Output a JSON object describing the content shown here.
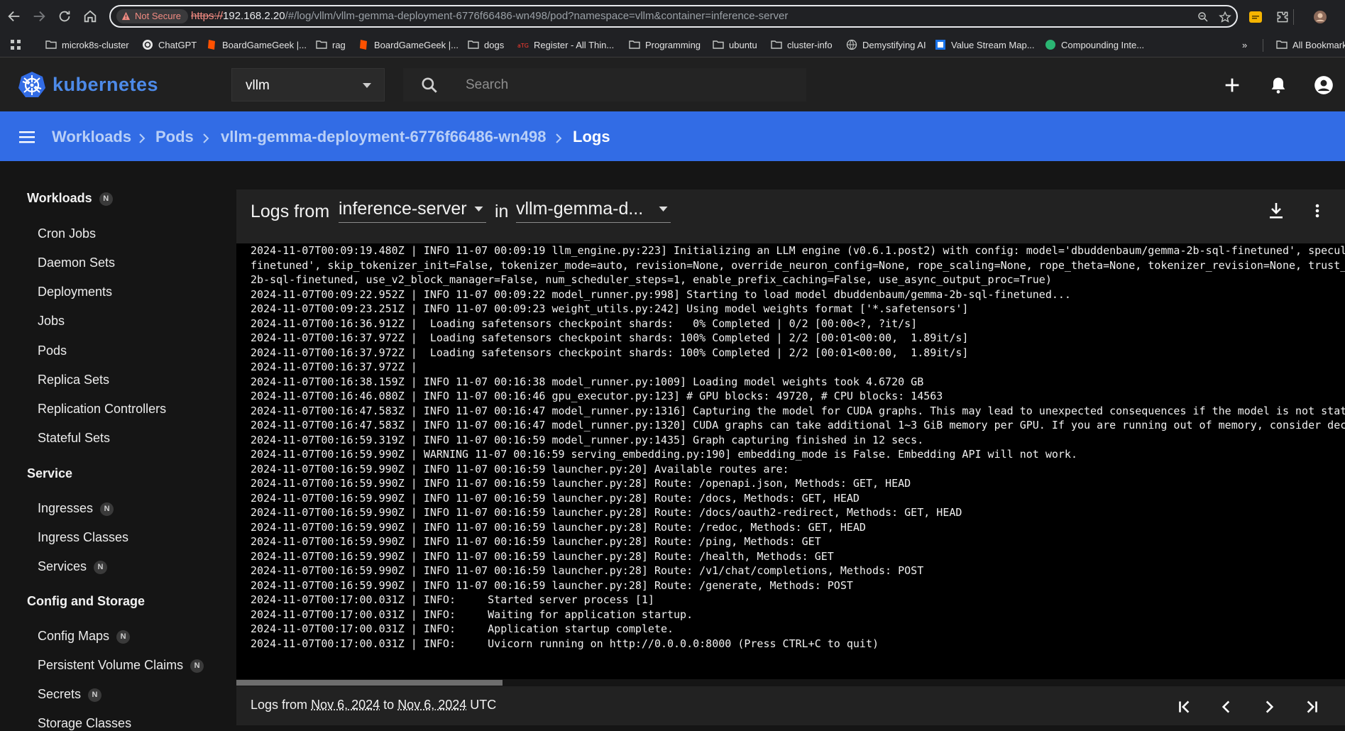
{
  "browser": {
    "security_label": "Not Secure",
    "url_scheme": "https://",
    "url_host": "192.168.2.20",
    "url_rest": "/#/log/vllm/vllm-gemma-deployment-6776f66486-wn498/pod?namespace=vllm&container=inference-server",
    "bookmarks": [
      {
        "label": "microk8s-cluster",
        "icon": "folder-icon"
      },
      {
        "label": "ChatGPT",
        "icon": "chatgpt-icon"
      },
      {
        "label": "BoardGameGeek |...",
        "icon": "boardgamegeek-icon"
      },
      {
        "label": "rag",
        "icon": "folder-icon"
      },
      {
        "label": "BoardGameGeek |...",
        "icon": "boardgamegeek-icon"
      },
      {
        "label": "dogs",
        "icon": "folder-icon"
      },
      {
        "label": "Register - All Thin...",
        "icon": "register-icon"
      },
      {
        "label": "Programming",
        "icon": "folder-icon"
      },
      {
        "label": "ubuntu",
        "icon": "folder-icon"
      },
      {
        "label": "cluster-info",
        "icon": "folder-icon"
      },
      {
        "label": "Demystifying AI",
        "icon": "globe-icon"
      },
      {
        "label": "Value Stream Map...",
        "icon": "site-icon"
      },
      {
        "label": "Compounding Inte...",
        "icon": "site-icon"
      }
    ],
    "more_label": "»",
    "all_bookmarks_label": "All Bookmarks"
  },
  "app": {
    "name": "kubernetes",
    "namespace": "vllm",
    "search_placeholder": "Search",
    "brand_color": "#326ce5"
  },
  "breadcrumb": [
    "Workloads",
    "Pods",
    "vllm-gemma-deployment-6776f66486-wn498",
    "Logs"
  ],
  "sidebar": {
    "workloads": {
      "title": "Workloads",
      "badge": "N",
      "items": [
        "Cron Jobs",
        "Daemon Sets",
        "Deployments",
        "Jobs",
        "Pods",
        "Replica Sets",
        "Replication Controllers",
        "Stateful Sets"
      ]
    },
    "service": {
      "title": "Service",
      "items": [
        {
          "label": "Ingresses",
          "badge": "N"
        },
        {
          "label": "Ingress Classes",
          "badge": ""
        },
        {
          "label": "Services",
          "badge": "N"
        }
      ]
    },
    "config": {
      "title": "Config and Storage",
      "items": [
        {
          "label": "Config Maps",
          "badge": "N"
        },
        {
          "label": "Persistent Volume Claims",
          "badge": "N"
        },
        {
          "label": "Secrets",
          "badge": "N"
        },
        {
          "label": "Storage Classes",
          "badge": ""
        }
      ]
    }
  },
  "logs": {
    "prefix": "Logs from",
    "container": "inference-server",
    "in_label": "in",
    "pod": "vllm-gemma-d...",
    "lines": [
      "2024-11-07T00:09:19.480Z | INFO 11-07 00:09:19 llm_engine.py:223] Initializing an LLM engine (v0.6.1.post2) with config: model='dbuddenbaum/gemma-2b-sql-finetuned', specul",
      "finetuned', skip_tokenizer_init=False, tokenizer_mode=auto, revision=None, override_neuron_config=None, rope_scaling=None, rope_theta=None, tokenizer_revision=None, trust_",
      "2b-sql-finetuned, use_v2_block_manager=False, num_scheduler_steps=1, enable_prefix_caching=False, use_async_output_proc=True)",
      "2024-11-07T00:09:22.952Z | INFO 11-07 00:09:22 model_runner.py:998] Starting to load model dbuddenbaum/gemma-2b-sql-finetuned...",
      "2024-11-07T00:09:23.251Z | INFO 11-07 00:09:23 weight_utils.py:242] Using model weights format ['*.safetensors']",
      "2024-11-07T00:16:36.912Z |  Loading safetensors checkpoint shards:   0% Completed | 0/2 [00:00<?, ?it/s]",
      "2024-11-07T00:16:37.972Z |  Loading safetensors checkpoint shards: 100% Completed | 2/2 [00:01<00:00,  1.89it/s]",
      "2024-11-07T00:16:37.972Z |  Loading safetensors checkpoint shards: 100% Completed | 2/2 [00:01<00:00,  1.89it/s]",
      "2024-11-07T00:16:37.972Z |",
      "2024-11-07T00:16:38.159Z | INFO 11-07 00:16:38 model_runner.py:1009] Loading model weights took 4.6720 GB",
      "2024-11-07T00:16:46.080Z | INFO 11-07 00:16:46 gpu_executor.py:123] # GPU blocks: 49720, # CPU blocks: 14563",
      "2024-11-07T00:16:47.583Z | INFO 11-07 00:16:47 model_runner.py:1316] Capturing the model for CUDA graphs. This may lead to unexpected consequences if the model is not stat",
      "2024-11-07T00:16:47.583Z | INFO 11-07 00:16:47 model_runner.py:1320] CUDA graphs can take additional 1~3 GiB memory per GPU. If you are running out of memory, consider dec",
      "2024-11-07T00:16:59.319Z | INFO 11-07 00:16:59 model_runner.py:1435] Graph capturing finished in 12 secs.",
      "2024-11-07T00:16:59.990Z | WARNING 11-07 00:16:59 serving_embedding.py:190] embedding_mode is False. Embedding API will not work.",
      "2024-11-07T00:16:59.990Z | INFO 11-07 00:16:59 launcher.py:20] Available routes are:",
      "2024-11-07T00:16:59.990Z | INFO 11-07 00:16:59 launcher.py:28] Route: /openapi.json, Methods: GET, HEAD",
      "2024-11-07T00:16:59.990Z | INFO 11-07 00:16:59 launcher.py:28] Route: /docs, Methods: GET, HEAD",
      "2024-11-07T00:16:59.990Z | INFO 11-07 00:16:59 launcher.py:28] Route: /docs/oauth2-redirect, Methods: GET, HEAD",
      "2024-11-07T00:16:59.990Z | INFO 11-07 00:16:59 launcher.py:28] Route: /redoc, Methods: GET, HEAD",
      "2024-11-07T00:16:59.990Z | INFO 11-07 00:16:59 launcher.py:28] Route: /ping, Methods: GET",
      "2024-11-07T00:16:59.990Z | INFO 11-07 00:16:59 launcher.py:28] Route: /health, Methods: GET",
      "2024-11-07T00:16:59.990Z | INFO 11-07 00:16:59 launcher.py:28] Route: /v1/chat/completions, Methods: POST",
      "2024-11-07T00:16:59.990Z | INFO 11-07 00:16:59 launcher.py:28] Route: /generate, Methods: POST",
      "2024-11-07T00:17:00.031Z | INFO:     Started server process [1]",
      "2024-11-07T00:17:00.031Z | INFO:     Waiting for application startup.",
      "2024-11-07T00:17:00.031Z | INFO:     Application startup complete.",
      "2024-11-07T00:17:00.031Z | INFO:     Uvicorn running on http://0.0.0.0:8000 (Press CTRL+C to quit)"
    ],
    "footer_prefix": "Logs from",
    "footer_from": "Nov 6, 2024",
    "footer_to_label": "to",
    "footer_to": "Nov 6, 2024",
    "footer_suffix": "UTC",
    "horizontal_scroll_fraction": 0.24
  }
}
